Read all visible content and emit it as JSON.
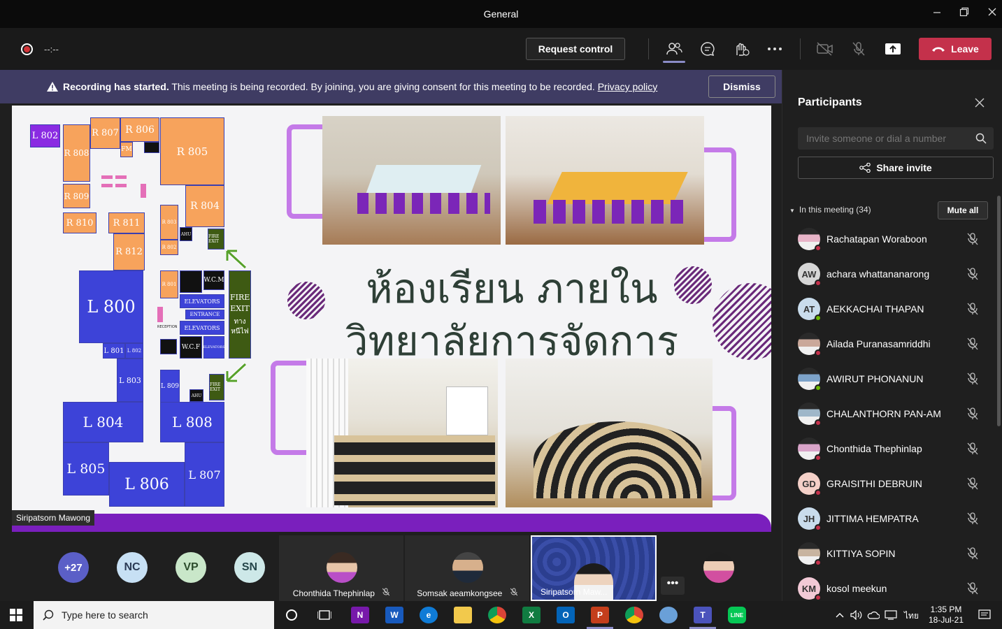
{
  "window": {
    "title": "General"
  },
  "toolbar": {
    "timer": "--:--",
    "request_control": "Request control",
    "leave": "Leave"
  },
  "banner": {
    "bold": "Recording has started.",
    "text": "This meeting is being recorded. By joining, you are giving consent for this meeting to be recorded.",
    "link": "Privacy policy",
    "dismiss": "Dismiss"
  },
  "slide": {
    "thai_line1": "ห้องเรียน ภายใน",
    "thai_line2": "วิทยาลัยการจัดการ",
    "rooms": {
      "l802": "L 802",
      "r807": "R 807",
      "r806": "R 806",
      "r808": "R 808",
      "fm": "FM",
      "r805": "R 805",
      "r809": "R 809",
      "r804": "R 804",
      "r810": "R 810",
      "r811": "R 811",
      "r803": "R 803",
      "r812": "R 812",
      "r802": "R 802",
      "ahu1": "AHU",
      "fire1": "FIRE EXIT",
      "l800": "L 800",
      "r801": "R 801",
      "wcm": "W.C.M",
      "elev1": "ELEVATORS",
      "entrance": "ENTRANCE",
      "reception": "RECEPTION",
      "elev2": "ELEVATORS",
      "wcf": "W.C.F",
      "elev3": "ELEVATORS",
      "fire_big": "FIRE EXIT",
      "fire_thai": "ทางหนีไฟ",
      "l801": "L 801",
      "l802b": "L 802",
      "l803": "L 803",
      "l809": "L 809",
      "ahu2": "AHU",
      "fire2": "FIRE EXIT",
      "l804": "L 804",
      "l808": "L 808",
      "l805": "L 805",
      "l806": "L 806",
      "l807": "L 807"
    },
    "presenter": "Siripatsorn Mawong"
  },
  "strip": {
    "overflow": "+27",
    "avatars": [
      {
        "initials": "NC",
        "color": "#c7e0f4",
        "text": "#2b3a55"
      },
      {
        "initials": "VP",
        "color": "#c9e7c9",
        "text": "#2d4d2d"
      },
      {
        "initials": "SN",
        "color": "#cde8e8",
        "text": "#24464a"
      }
    ],
    "tiles": [
      {
        "name": "Chonthida Thephinlap"
      },
      {
        "name": "Somsak aeamkongsee"
      },
      {
        "name": "Siripatsorn Maw..."
      }
    ],
    "more": "•••"
  },
  "panel": {
    "title": "Participants",
    "invite_placeholder": "Invite someone or dial a number",
    "share_invite": "Share invite",
    "in_meeting": "In this meeting (34)",
    "mute_all": "Mute all",
    "participants": [
      {
        "name": "Rachatapan Woraboon",
        "initials": "",
        "photo": true,
        "status": "#c4314b",
        "bg": "#e8b4c8"
      },
      {
        "name": "achara whattananarong",
        "initials": "AW",
        "photo": false,
        "status": "#c4314b",
        "bg": "#d6d6d6"
      },
      {
        "name": "AEKKACHAI THAPAN",
        "initials": "AT",
        "photo": false,
        "status": "#6bb700",
        "bg": "#c9dcec"
      },
      {
        "name": "Ailada Puranasamriddhi",
        "initials": "",
        "photo": true,
        "status": "#c4314b",
        "bg": "#caa89a"
      },
      {
        "name": "AWIRUT PHONANUN",
        "initials": "",
        "photo": true,
        "status": "#6bb700",
        "bg": "#7da3c9"
      },
      {
        "name": "CHALANTHORN PAN-AM",
        "initials": "",
        "photo": true,
        "status": "#c4314b",
        "bg": "#9fb7c9"
      },
      {
        "name": "Chonthida Thephinlap",
        "initials": "",
        "photo": true,
        "status": "#c4314b",
        "bg": "#d9a4c9"
      },
      {
        "name": "GRAISITHI DEBRUIN",
        "initials": "GD",
        "photo": false,
        "status": "#c4314b",
        "bg": "#f4d0c8"
      },
      {
        "name": "JITTIMA HEMPATRA",
        "initials": "JH",
        "photo": false,
        "status": "#c4314b",
        "bg": "#c9dcec"
      },
      {
        "name": "KITTIYA SOPIN",
        "initials": "",
        "photo": true,
        "status": "#c4314b",
        "bg": "#c8b4a0"
      },
      {
        "name": "kosol meekun",
        "initials": "KM",
        "photo": false,
        "status": "#c4314b",
        "bg": "#f2c9d6"
      }
    ]
  },
  "taskbar": {
    "search": "Type here to search",
    "time": "1:35 PM",
    "date": "18-Jul-21",
    "lang": "ไทย"
  }
}
